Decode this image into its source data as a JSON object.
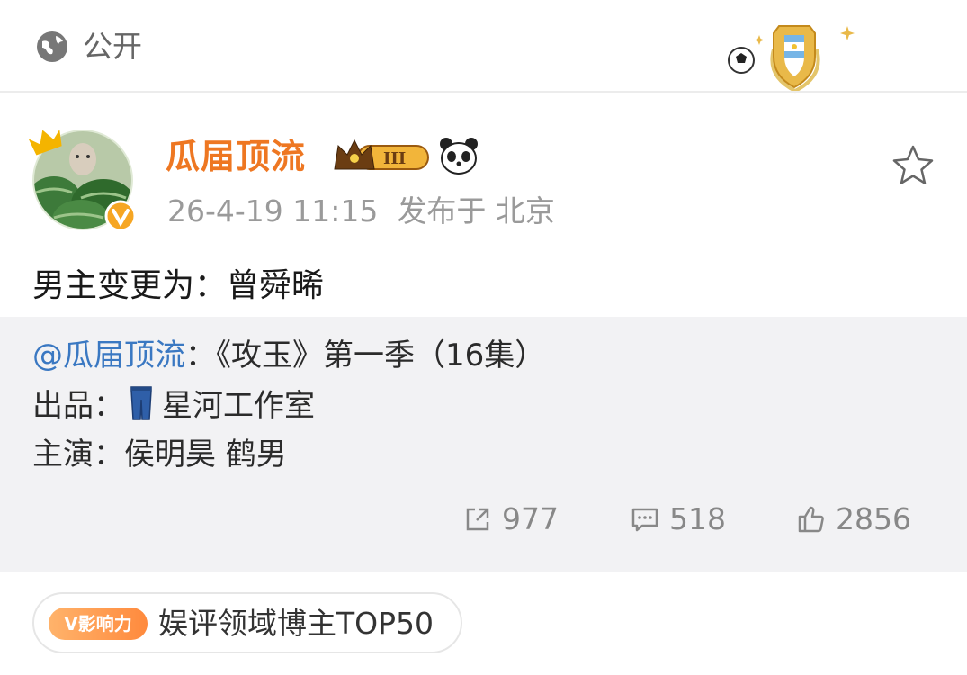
{
  "header": {
    "visibility_label": "公开",
    "badge_icon": "argentina-football-badge-icon"
  },
  "post": {
    "author": "瓜届顶流",
    "level_label": "III",
    "timestamp": "26-4-19 11:15",
    "location": "发布于 北京",
    "text": "男主变更为：曾舜晞"
  },
  "repost": {
    "mention": "@瓜届顶流",
    "title": "：《攻玉》第一季（16集）",
    "producer_label": "出品：",
    "producer_value": "星河工作室",
    "cast_label": "主演：",
    "cast_value": "侯明昊 鹤男",
    "stats": {
      "reposts": "977",
      "comments": "518",
      "likes": "2856"
    }
  },
  "footer": {
    "influence_tag": "V影响力",
    "influence_text": "娱评领域博主TOP50"
  },
  "colors": {
    "author": "#ee7722",
    "mention": "#3a78c2",
    "repost_bg": "#f2f2f4"
  }
}
